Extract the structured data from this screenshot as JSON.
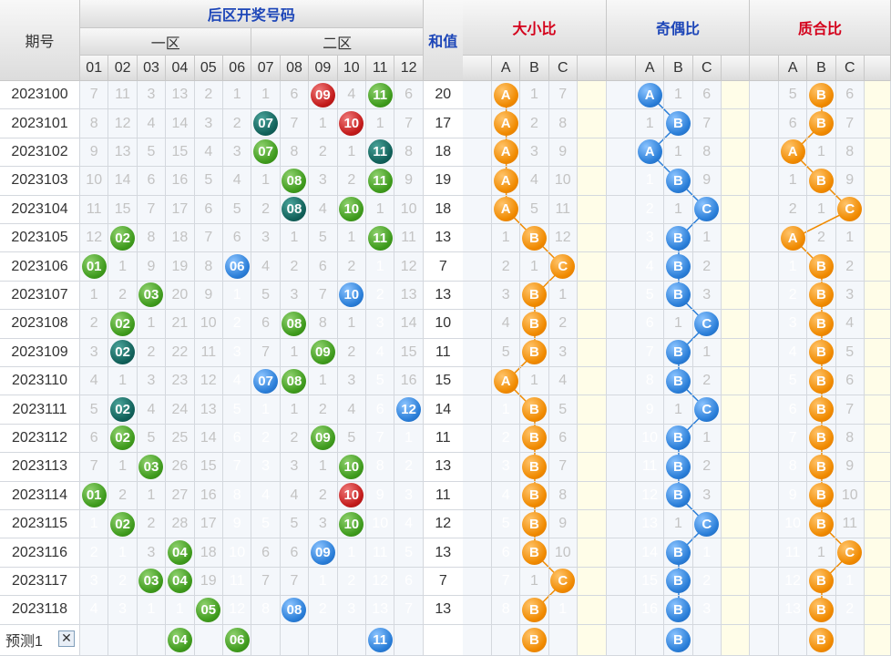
{
  "header": {
    "period": "期号",
    "back_zone": "后区开奖号码",
    "zone1": "一区",
    "zone2": "二区",
    "sum": "和值",
    "size_ratio": "大小比",
    "odd_even_ratio": "奇偶比",
    "prime_ratio": "质合比",
    "numbers": [
      "01",
      "02",
      "03",
      "04",
      "05",
      "06",
      "07",
      "08",
      "09",
      "10",
      "11",
      "12"
    ],
    "abc": [
      "A",
      "B",
      "C"
    ]
  },
  "colors": {
    "green": "#3f9b1d",
    "teal": "#11615a",
    "red": "#c31b1b",
    "blue": "#2a7ed8",
    "orange": "#f08a00"
  },
  "rows": [
    {
      "period": "2023100",
      "nums": [
        "7",
        "11",
        "3",
        "13",
        "2",
        "1",
        "1",
        "6",
        {
          "v": "09",
          "c": "red"
        },
        "4",
        {
          "v": "11",
          "c": "green"
        },
        "6"
      ],
      "sum": "20",
      "size": [
        {
          "v": "A",
          "hit": true
        },
        "1",
        "7"
      ],
      "oe": [
        {
          "v": "A",
          "hit": true
        },
        "1",
        "6"
      ],
      "pr": [
        "5",
        {
          "v": "B",
          "hit": true
        },
        "6"
      ]
    },
    {
      "period": "2023101",
      "nums": [
        "8",
        "12",
        "4",
        "14",
        "3",
        "2",
        {
          "v": "07",
          "c": "teal"
        },
        "7",
        "1",
        {
          "v": "10",
          "c": "red"
        },
        "1",
        "7"
      ],
      "sum": "17",
      "size": [
        {
          "v": "A",
          "hit": true
        },
        "2",
        "8"
      ],
      "oe": [
        "1",
        {
          "v": "B",
          "hit": true
        },
        "7"
      ],
      "pr": [
        "6",
        {
          "v": "B",
          "hit": true
        },
        "7"
      ]
    },
    {
      "period": "2023102",
      "nums": [
        "9",
        "13",
        "5",
        "15",
        "4",
        "3",
        {
          "v": "07",
          "c": "green"
        },
        "8",
        "2",
        "1",
        {
          "v": "11",
          "c": "teal"
        },
        "8"
      ],
      "sum": "18",
      "size": [
        {
          "v": "A",
          "hit": true
        },
        "3",
        "9"
      ],
      "oe": [
        {
          "v": "A",
          "hit": true
        },
        "1",
        "8"
      ],
      "pr": [
        {
          "v": "A",
          "hit": true
        },
        "1",
        "8"
      ]
    },
    {
      "period": "2023103",
      "nums": [
        "10",
        "14",
        "6",
        "16",
        "5",
        "4",
        "1",
        {
          "v": "08",
          "c": "green"
        },
        "3",
        "2",
        {
          "v": "11",
          "c": "green"
        },
        "9"
      ],
      "sum": "19",
      "size": [
        {
          "v": "A",
          "hit": true
        },
        "4",
        "10"
      ],
      "oe": [
        {
          "v": "1",
          "g": true
        },
        {
          "v": "B",
          "hit": true
        },
        "9"
      ],
      "pr": [
        "1",
        {
          "v": "B",
          "hit": true
        },
        "9"
      ]
    },
    {
      "period": "2023104",
      "nums": [
        "11",
        "15",
        "7",
        "17",
        "6",
        "5",
        "2",
        {
          "v": "08",
          "c": "teal"
        },
        "4",
        {
          "v": "10",
          "c": "green"
        },
        "1",
        "10"
      ],
      "sum": "18",
      "size": [
        {
          "v": "A",
          "hit": true
        },
        "5",
        "11"
      ],
      "oe": [
        {
          "v": "2",
          "g": true
        },
        "1",
        {
          "v": "C",
          "hit": true
        }
      ],
      "pr": [
        "2",
        "1",
        {
          "v": "C",
          "hit": true
        }
      ]
    },
    {
      "period": "2023105",
      "nums": [
        "12",
        {
          "v": "02",
          "c": "green"
        },
        "8",
        "18",
        "7",
        "6",
        "3",
        "1",
        "5",
        "1",
        {
          "v": "11",
          "c": "green"
        },
        "11"
      ],
      "sum": "13",
      "size": [
        "1",
        {
          "v": "B",
          "hit": true
        },
        "12"
      ],
      "oe": [
        {
          "v": "3",
          "g": true
        },
        {
          "v": "B",
          "hit": true
        },
        "1"
      ],
      "pr": [
        {
          "v": "A",
          "hit": true
        },
        "2",
        "1"
      ]
    },
    {
      "period": "2023106",
      "nums": [
        {
          "v": "01",
          "c": "green"
        },
        "1",
        "9",
        "19",
        "8",
        {
          "v": "06",
          "c": "blue"
        },
        "4",
        "2",
        "6",
        "2",
        {
          "v": "1",
          "g": true
        },
        "12"
      ],
      "sum": "7",
      "size": [
        "2",
        "1",
        {
          "v": "C",
          "hit": true
        }
      ],
      "oe": [
        {
          "v": "4",
          "g": true
        },
        {
          "v": "B",
          "hit": true
        },
        "2"
      ],
      "pr": [
        {
          "v": "1",
          "g": true
        },
        {
          "v": "B",
          "hit": true
        },
        "2"
      ]
    },
    {
      "period": "2023107",
      "nums": [
        "1",
        "2",
        {
          "v": "03",
          "c": "green"
        },
        "20",
        "9",
        {
          "v": "1",
          "g": true
        },
        "5",
        "3",
        "7",
        {
          "v": "10",
          "c": "blue"
        },
        {
          "v": "2",
          "g": true
        },
        "13"
      ],
      "sum": "13",
      "size": [
        "3",
        {
          "v": "B",
          "hit": true
        },
        "1"
      ],
      "oe": [
        {
          "v": "5",
          "g": true
        },
        {
          "v": "B",
          "hit": true
        },
        "3"
      ],
      "pr": [
        {
          "v": "2",
          "g": true
        },
        {
          "v": "B",
          "hit": true
        },
        "3"
      ]
    },
    {
      "period": "2023108",
      "nums": [
        "2",
        {
          "v": "02",
          "c": "green"
        },
        "1",
        "21",
        "10",
        {
          "v": "2",
          "g": true
        },
        "6",
        {
          "v": "08",
          "c": "green"
        },
        "8",
        "1",
        {
          "v": "3",
          "g": true
        },
        "14"
      ],
      "sum": "10",
      "size": [
        "4",
        {
          "v": "B",
          "hit": true
        },
        "2"
      ],
      "oe": [
        {
          "v": "6",
          "g": true
        },
        "1",
        {
          "v": "C",
          "hit": true
        }
      ],
      "pr": [
        {
          "v": "3",
          "g": true
        },
        {
          "v": "B",
          "hit": true
        },
        "4"
      ]
    },
    {
      "period": "2023109",
      "nums": [
        "3",
        {
          "v": "02",
          "c": "teal"
        },
        "2",
        "22",
        "11",
        {
          "v": "3",
          "g": true
        },
        "7",
        "1",
        {
          "v": "09",
          "c": "green"
        },
        "2",
        {
          "v": "4",
          "g": true
        },
        "15"
      ],
      "sum": "11",
      "size": [
        "5",
        {
          "v": "B",
          "hit": true
        },
        "3"
      ],
      "oe": [
        {
          "v": "7",
          "g": true
        },
        {
          "v": "B",
          "hit": true
        },
        "1"
      ],
      "pr": [
        {
          "v": "4",
          "g": true
        },
        {
          "v": "B",
          "hit": true
        },
        "5"
      ]
    },
    {
      "period": "2023110",
      "nums": [
        "4",
        "1",
        "3",
        "23",
        "12",
        {
          "v": "4",
          "g": true
        },
        {
          "v": "07",
          "c": "blue"
        },
        {
          "v": "08",
          "c": "green"
        },
        "1",
        "3",
        {
          "v": "5",
          "g": true
        },
        "16"
      ],
      "sum": "15",
      "size": [
        {
          "v": "A",
          "hit": true
        },
        "1",
        "4"
      ],
      "oe": [
        {
          "v": "8",
          "g": true
        },
        {
          "v": "B",
          "hit": true
        },
        "2"
      ],
      "pr": [
        {
          "v": "5",
          "g": true
        },
        {
          "v": "B",
          "hit": true
        },
        "6"
      ]
    },
    {
      "period": "2023111",
      "nums": [
        "5",
        {
          "v": "02",
          "c": "teal"
        },
        "4",
        "24",
        "13",
        {
          "v": "5",
          "g": true
        },
        {
          "v": "1",
          "g": true
        },
        "1",
        "2",
        "4",
        {
          "v": "6",
          "g": true
        },
        {
          "v": "12",
          "c": "blue"
        }
      ],
      "sum": "14",
      "size": [
        {
          "v": "1",
          "g": true
        },
        {
          "v": "B",
          "hit": true
        },
        "5"
      ],
      "oe": [
        {
          "v": "9",
          "g": true
        },
        "1",
        {
          "v": "C",
          "hit": true
        }
      ],
      "pr": [
        {
          "v": "6",
          "g": true
        },
        {
          "v": "B",
          "hit": true
        },
        "7"
      ]
    },
    {
      "period": "2023112",
      "nums": [
        "6",
        {
          "v": "02",
          "c": "green"
        },
        "5",
        "25",
        "14",
        {
          "v": "6",
          "g": true
        },
        {
          "v": "2",
          "g": true
        },
        "2",
        {
          "v": "09",
          "c": "green"
        },
        "5",
        {
          "v": "7",
          "g": true
        },
        {
          "v": "1",
          "g": true
        }
      ],
      "sum": "11",
      "size": [
        {
          "v": "2",
          "g": true
        },
        {
          "v": "B",
          "hit": true
        },
        "6"
      ],
      "oe": [
        {
          "v": "10",
          "g": true
        },
        {
          "v": "B",
          "hit": true
        },
        "1"
      ],
      "pr": [
        {
          "v": "7",
          "g": true
        },
        {
          "v": "B",
          "hit": true
        },
        "8"
      ]
    },
    {
      "period": "2023113",
      "nums": [
        "7",
        "1",
        {
          "v": "03",
          "c": "green"
        },
        "26",
        "15",
        {
          "v": "7",
          "g": true
        },
        {
          "v": "3",
          "g": true
        },
        "3",
        "1",
        {
          "v": "10",
          "c": "green"
        },
        {
          "v": "8",
          "g": true
        },
        {
          "v": "2",
          "g": true
        }
      ],
      "sum": "13",
      "size": [
        {
          "v": "3",
          "g": true
        },
        {
          "v": "B",
          "hit": true
        },
        "7"
      ],
      "oe": [
        {
          "v": "11",
          "g": true
        },
        {
          "v": "B",
          "hit": true
        },
        "2"
      ],
      "pr": [
        {
          "v": "8",
          "g": true
        },
        {
          "v": "B",
          "hit": true
        },
        "9"
      ]
    },
    {
      "period": "2023114",
      "nums": [
        {
          "v": "01",
          "c": "green"
        },
        "2",
        "1",
        "27",
        "16",
        {
          "v": "8",
          "g": true
        },
        {
          "v": "4",
          "g": true
        },
        "4",
        "2",
        {
          "v": "10",
          "c": "red"
        },
        {
          "v": "9",
          "g": true
        },
        {
          "v": "3",
          "g": true
        }
      ],
      "sum": "11",
      "size": [
        {
          "v": "4",
          "g": true
        },
        {
          "v": "B",
          "hit": true
        },
        "8"
      ],
      "oe": [
        {
          "v": "12",
          "g": true
        },
        {
          "v": "B",
          "hit": true
        },
        "3"
      ],
      "pr": [
        {
          "v": "9",
          "g": true
        },
        {
          "v": "B",
          "hit": true
        },
        "10"
      ]
    },
    {
      "period": "2023115",
      "nums": [
        {
          "v": "1",
          "g": true
        },
        {
          "v": "02",
          "c": "green"
        },
        "2",
        "28",
        "17",
        {
          "v": "9",
          "g": true
        },
        {
          "v": "5",
          "g": true
        },
        "5",
        "3",
        {
          "v": "10",
          "c": "green"
        },
        {
          "v": "10",
          "g": true
        },
        {
          "v": "4",
          "g": true
        }
      ],
      "sum": "12",
      "size": [
        {
          "v": "5",
          "g": true
        },
        {
          "v": "B",
          "hit": true
        },
        "9"
      ],
      "oe": [
        {
          "v": "13",
          "g": true
        },
        "1",
        {
          "v": "C",
          "hit": true
        }
      ],
      "pr": [
        {
          "v": "10",
          "g": true
        },
        {
          "v": "B",
          "hit": true
        },
        "11"
      ]
    },
    {
      "period": "2023116",
      "nums": [
        {
          "v": "2",
          "g": true
        },
        {
          "v": "1",
          "g": true
        },
        "3",
        {
          "v": "04",
          "c": "green"
        },
        "18",
        {
          "v": "10",
          "g": true
        },
        "6",
        "6",
        {
          "v": "09",
          "c": "blue"
        },
        {
          "v": "1",
          "g": true
        },
        {
          "v": "11",
          "g": true
        },
        {
          "v": "5",
          "g": true
        }
      ],
      "sum": "13",
      "size": [
        {
          "v": "6",
          "g": true
        },
        {
          "v": "B",
          "hit": true
        },
        "10"
      ],
      "oe": [
        {
          "v": "14",
          "g": true
        },
        {
          "v": "B",
          "hit": true
        },
        {
          "v": "1",
          "g": true
        }
      ],
      "pr": [
        {
          "v": "11",
          "g": true
        },
        "1",
        {
          "v": "C",
          "hit": true
        }
      ]
    },
    {
      "period": "2023117",
      "nums": [
        {
          "v": "3",
          "g": true
        },
        {
          "v": "2",
          "g": true
        },
        {
          "v": "03",
          "c": "green"
        },
        {
          "v": "04",
          "c": "green"
        },
        "19",
        {
          "v": "11",
          "g": true
        },
        "7",
        "7",
        {
          "v": "1",
          "g": true
        },
        {
          "v": "2",
          "g": true
        },
        {
          "v": "12",
          "g": true
        },
        {
          "v": "6",
          "g": true
        }
      ],
      "sum": "7",
      "size": [
        {
          "v": "7",
          "g": true
        },
        "1",
        {
          "v": "C",
          "hit": true
        }
      ],
      "oe": [
        {
          "v": "15",
          "g": true
        },
        {
          "v": "B",
          "hit": true
        },
        {
          "v": "2",
          "g": true
        }
      ],
      "pr": [
        {
          "v": "12",
          "g": true
        },
        {
          "v": "B",
          "hit": true
        },
        {
          "v": "1",
          "g": true
        }
      ]
    },
    {
      "period": "2023118",
      "nums": [
        {
          "v": "4",
          "g": true
        },
        {
          "v": "3",
          "g": true
        },
        {
          "v": "1",
          "g": true
        },
        {
          "v": "1",
          "g": true
        },
        {
          "v": "05",
          "c": "green"
        },
        {
          "v": "12",
          "g": true
        },
        {
          "v": "8",
          "g": true
        },
        {
          "v": "08",
          "c": "blue"
        },
        {
          "v": "2",
          "g": true
        },
        {
          "v": "3",
          "g": true
        },
        {
          "v": "13",
          "g": true
        },
        {
          "v": "7",
          "g": true
        }
      ],
      "sum": "13",
      "size": [
        {
          "v": "8",
          "g": true
        },
        {
          "v": "B",
          "hit": true
        },
        {
          "v": "1",
          "g": true
        }
      ],
      "oe": [
        {
          "v": "16",
          "g": true
        },
        {
          "v": "B",
          "hit": true
        },
        {
          "v": "3",
          "g": true
        }
      ],
      "pr": [
        {
          "v": "13",
          "g": true
        },
        {
          "v": "B",
          "hit": true
        },
        {
          "v": "2",
          "g": true
        }
      ]
    }
  ],
  "predict": {
    "label": "预测1",
    "close": "✕",
    "nums": [
      "",
      "",
      "",
      {
        "v": "04",
        "c": "green"
      },
      "",
      {
        "v": "06",
        "c": "green"
      },
      "",
      "",
      "",
      "",
      {
        "v": "11",
        "c": "blue"
      },
      ""
    ],
    "size": "B",
    "oe": "B",
    "pr": "B"
  }
}
